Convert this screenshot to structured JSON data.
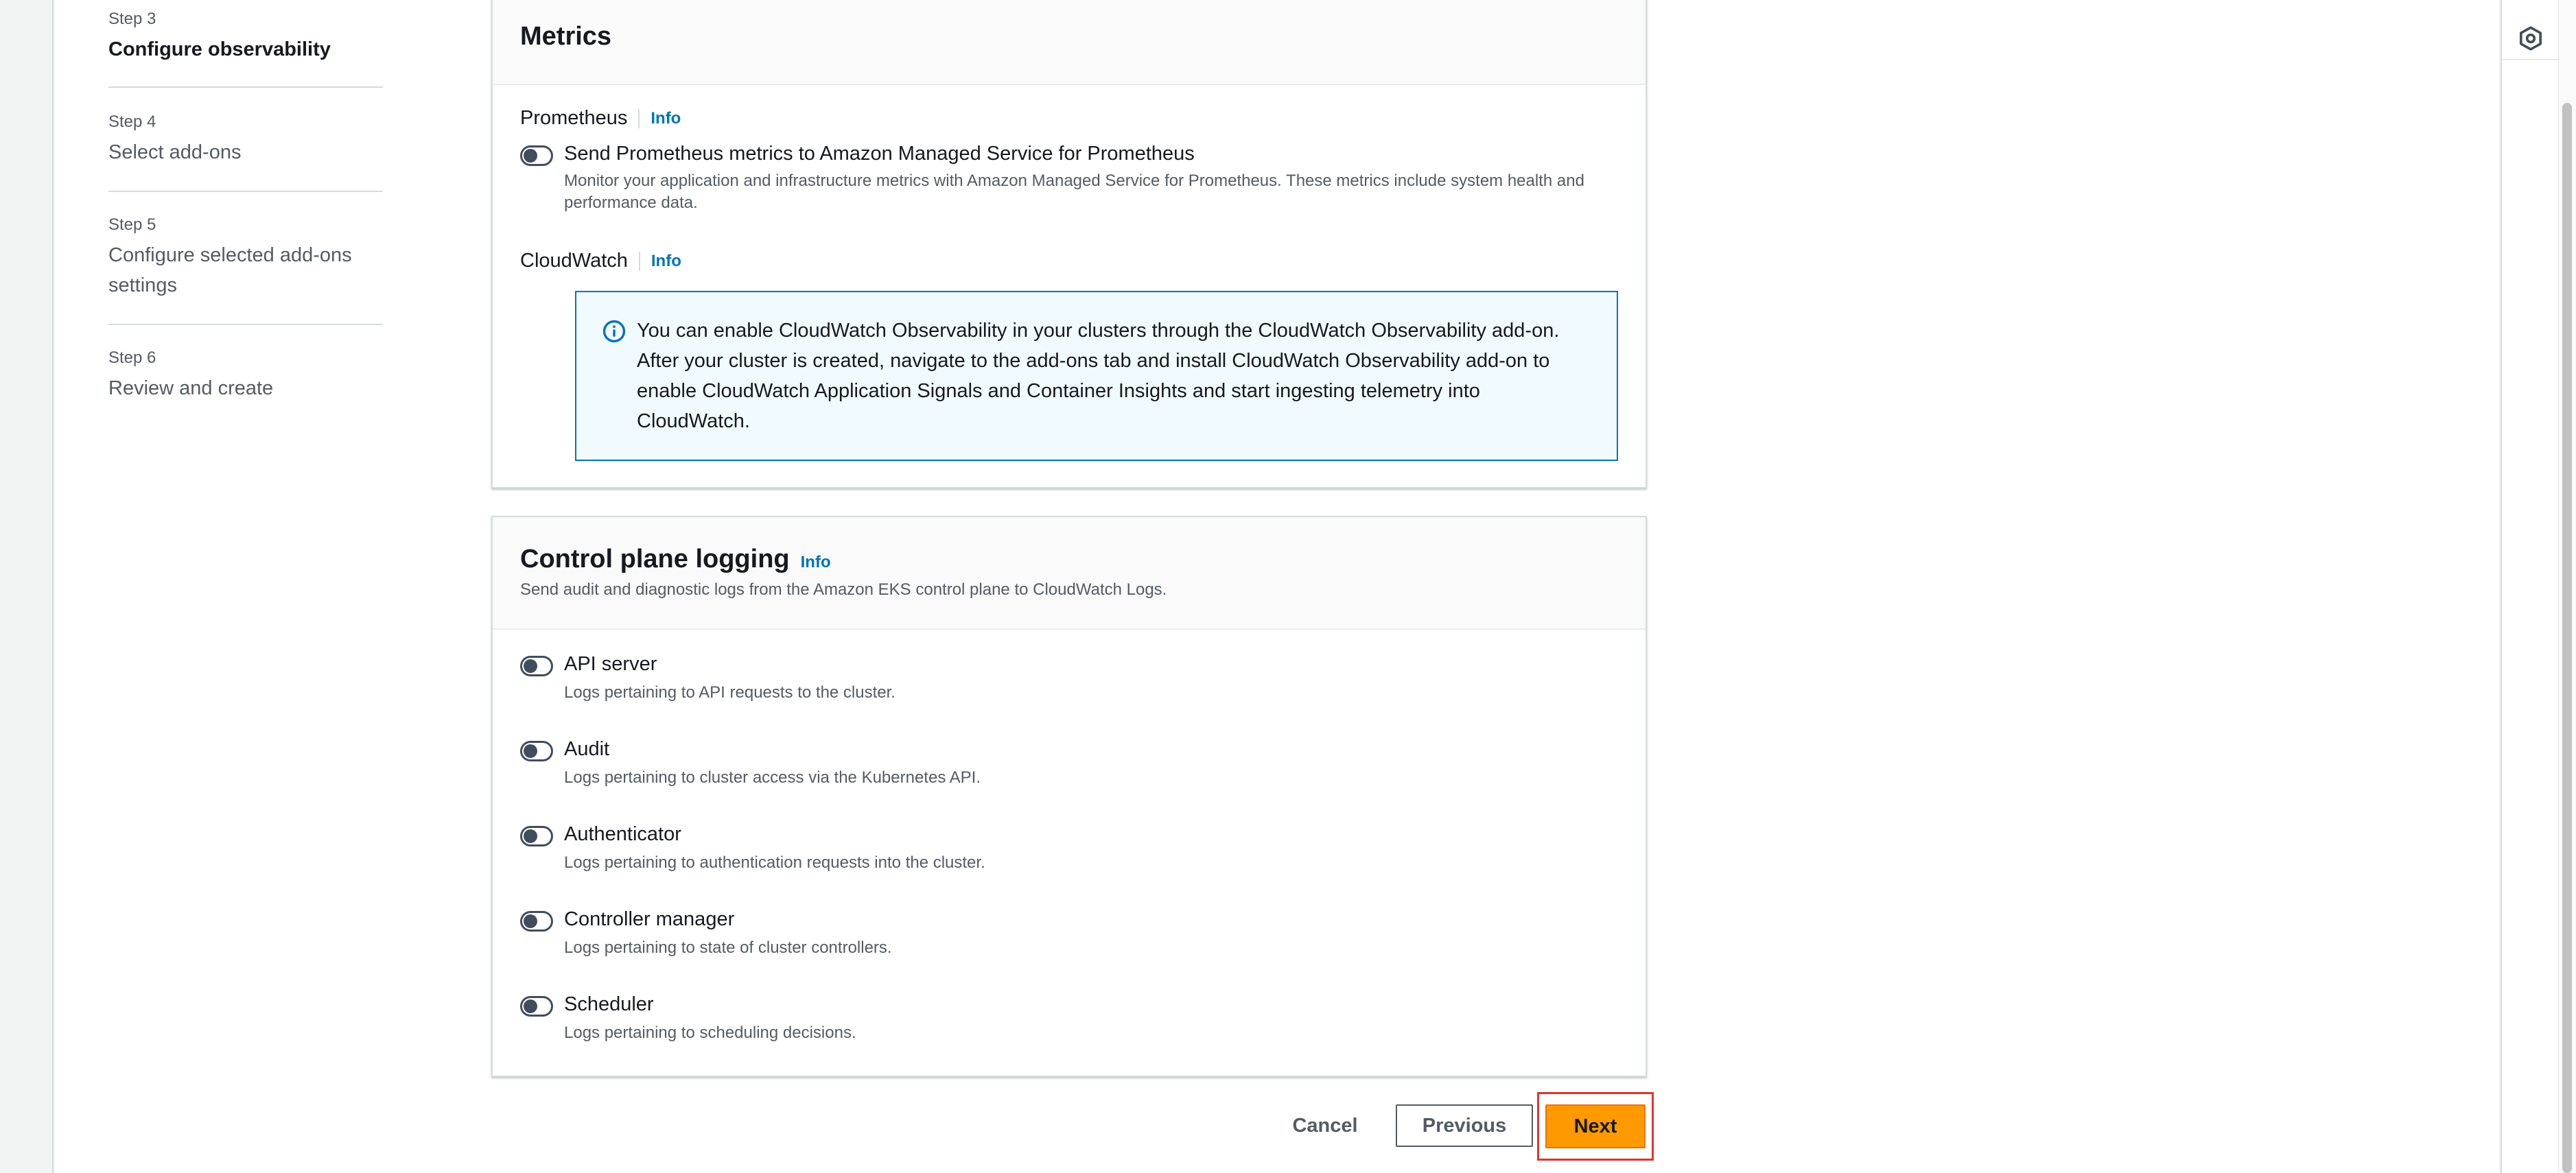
{
  "steps": [
    {
      "num": "Step 3",
      "name": "Configure observability",
      "current": true
    },
    {
      "num": "Step 4",
      "name": "Select add-ons"
    },
    {
      "num": "Step 5",
      "name": "Configure selected add-ons settings"
    },
    {
      "num": "Step 6",
      "name": "Review and create"
    }
  ],
  "metrics": {
    "title": "Metrics",
    "prometheus_label": "Prometheus",
    "cloudwatch_label": "CloudWatch",
    "info": "Info",
    "prometheus_toggle": {
      "label": "Send Prometheus metrics to Amazon Managed Service for Prometheus",
      "description": "Monitor your application and infrastructure metrics with Amazon Managed Service for Prometheus. These metrics include system health and performance data.",
      "checked": false
    },
    "cloudwatch_alert": "You can enable CloudWatch Observability in your clusters through the CloudWatch Observability add-on. After your cluster is created, navigate to the add-ons tab and install CloudWatch Observability add-on to enable CloudWatch Application Signals and Container Insights and start ingesting telemetry into CloudWatch."
  },
  "logging": {
    "title": "Control plane logging",
    "info": "Info",
    "description": "Send audit and diagnostic logs from the Amazon EKS control plane to CloudWatch Logs.",
    "items": [
      {
        "label": "API server",
        "description": "Logs pertaining to API requests to the cluster.",
        "checked": false
      },
      {
        "label": "Audit",
        "description": "Logs pertaining to cluster access via the Kubernetes API.",
        "checked": false
      },
      {
        "label": "Authenticator",
        "description": "Logs pertaining to authentication requests into the cluster.",
        "checked": false
      },
      {
        "label": "Controller manager",
        "description": "Logs pertaining to state of cluster controllers.",
        "checked": false
      },
      {
        "label": "Scheduler",
        "description": "Logs pertaining to scheduling decisions.",
        "checked": false
      }
    ]
  },
  "footer": {
    "cancel": "Cancel",
    "previous": "Previous",
    "next": "Next"
  },
  "icons": {
    "rail": "hexagon-settings-icon",
    "alert": "info-icon"
  },
  "colors": {
    "accent": "#ff9900",
    "link": "#0073bb",
    "highlight": "#e2352b"
  }
}
